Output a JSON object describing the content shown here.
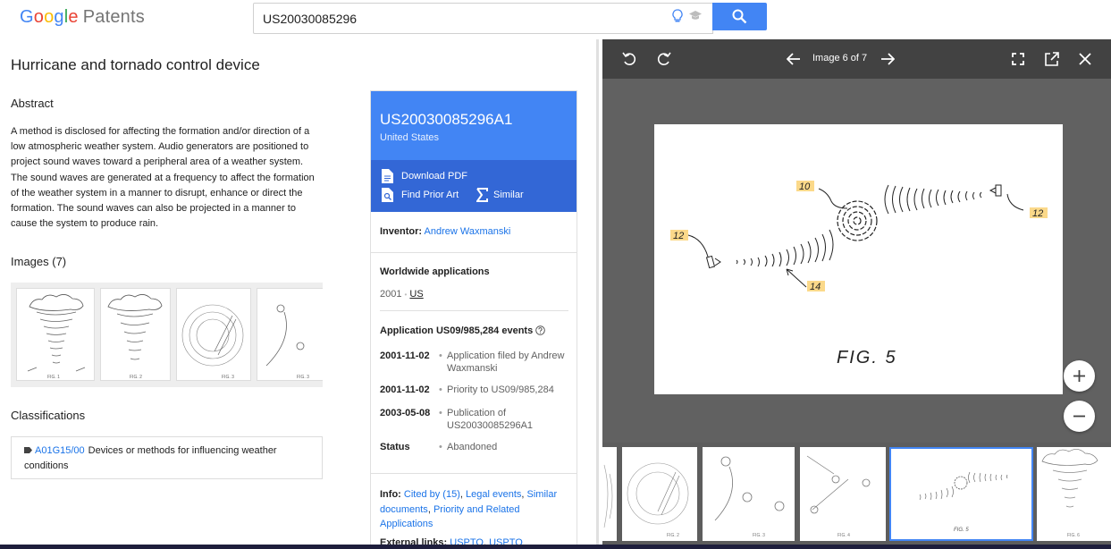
{
  "header": {
    "logo_google": [
      "G",
      "o",
      "o",
      "g",
      "l",
      "e"
    ],
    "logo_patents": "Patents",
    "search_value": "US20030085296",
    "icons": [
      "bulb-icon",
      "graduation-cap-icon",
      "search-icon"
    ],
    "accent_color": "#4285f4"
  },
  "main": {
    "title": "Hurricane and tornado control device",
    "abstract_heading": "Abstract",
    "abstract_text": "A method is disclosed for affecting the formation and/or direction of a low atmospheric weather system. Audio generators are positioned to project sound waves toward a peripheral area of a weather system. The sound waves are generated at a frequency to affect the formation of the weather system in a manner to disrupt, enhance or direct the formation. The sound waves can also be projected in a manner to cause the system to produce rain.",
    "images_heading": "Images (7)",
    "thumb_labels": [
      "FIG. 1",
      "FIG. 2",
      "FIG. 3"
    ],
    "classifications_heading": "Classifications",
    "classification": {
      "code": "A01G15/00",
      "description": "Devices or methods for influencing weather conditions"
    }
  },
  "card": {
    "publication_number": "US20030085296A1",
    "country": "United States",
    "download_pdf": "Download PDF",
    "find_prior_art": "Find Prior Art",
    "similar": "Similar",
    "inventor_label": "Inventor:",
    "inventor_name": "Andrew Waxmanski",
    "worldwide_heading": "Worldwide applications",
    "worldwide_year": "2001",
    "worldwide_dot": "•",
    "worldwide_country": "US",
    "events_heading": "Application US09/985,284 events",
    "events": [
      {
        "date": "2001-11-02",
        "text": "Application filed by Andrew Waxmanski"
      },
      {
        "date": "2001-11-02",
        "text": "Priority to US09/985,284"
      },
      {
        "date": "2003-05-08",
        "text": "Publication of US20030085296A1"
      },
      {
        "date": "Status",
        "text": "Abandoned"
      }
    ],
    "event_bullet": "•",
    "info_label": "Info:",
    "info_links": [
      "Cited by (15)",
      "Legal events",
      "Similar documents",
      "Priority and Related Applications"
    ],
    "info_sep": ", ",
    "info_and": " and ",
    "external_label": "External links:",
    "external_links": [
      "USPTO",
      "USPTO"
    ]
  },
  "viewer": {
    "image_counter": "Image 6 of 7",
    "figure_caption": "FIG. 5",
    "figure_labels": [
      "10",
      "12",
      "12",
      "14"
    ],
    "strip_labels": [
      "FIG. 2",
      "FIG. 3",
      "FIG. 4",
      "FIG. 5",
      "FIG. 6"
    ],
    "selected_index": 4
  }
}
